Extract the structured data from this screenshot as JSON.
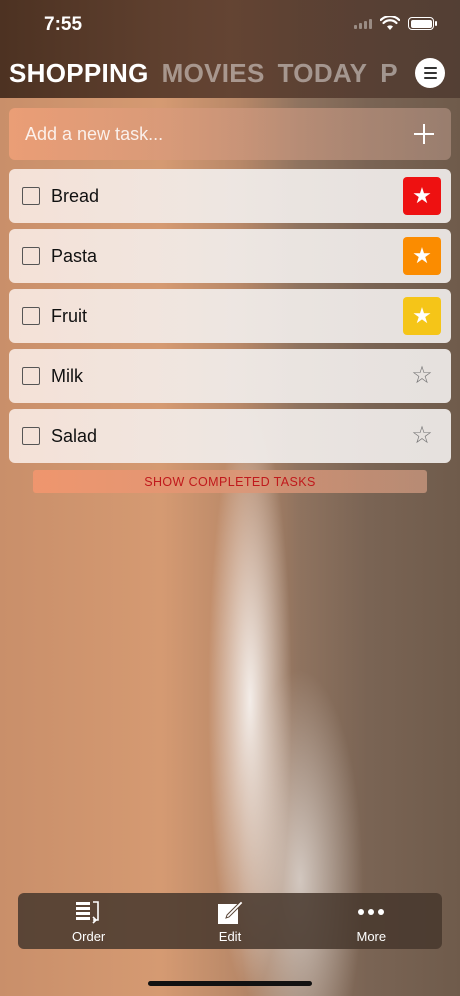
{
  "status": {
    "time": "7:55"
  },
  "tabs": [
    {
      "label": "SHOPPING",
      "active": true
    },
    {
      "label": "MOVIES",
      "active": false
    },
    {
      "label": "TODAY",
      "active": false
    },
    {
      "label": "P",
      "active": false
    }
  ],
  "add_task": {
    "placeholder": "Add a new task..."
  },
  "tasks": [
    {
      "label": "Bread",
      "priority": "high",
      "star_color": "#ee1111"
    },
    {
      "label": "Pasta",
      "priority": "medium",
      "star_color": "#fb8c00"
    },
    {
      "label": "Fruit",
      "priority": "low",
      "star_color": "#f5c518"
    },
    {
      "label": "Milk",
      "priority": "none"
    },
    {
      "label": "Salad",
      "priority": "none"
    }
  ],
  "show_completed_label": "SHOW COMPLETED TASKS",
  "toolbar": {
    "order_label": "Order",
    "edit_label": "Edit",
    "more_label": "More"
  },
  "icons": {
    "menu": "menu-icon",
    "plus": "plus-icon",
    "star_filled": "★",
    "star_outline": "☆"
  }
}
